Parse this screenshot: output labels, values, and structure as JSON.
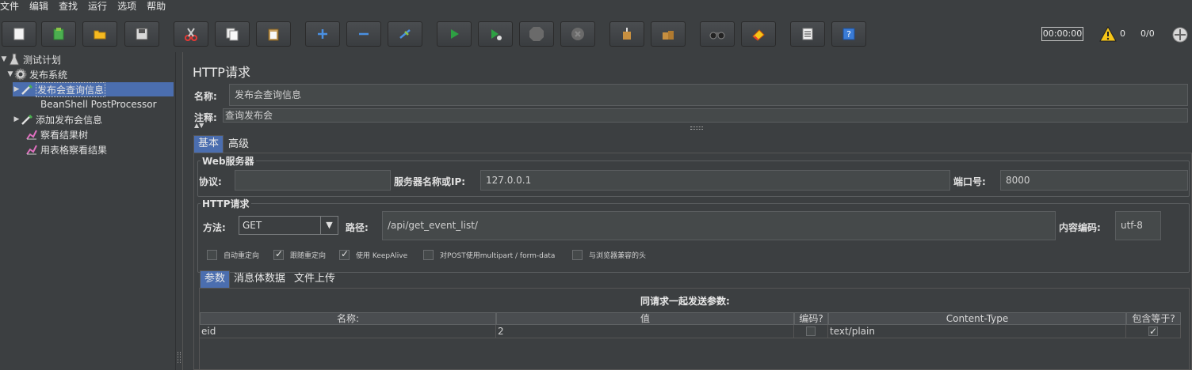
{
  "menu": [
    "文件",
    "编辑",
    "查找",
    "运行",
    "选项",
    "帮助"
  ],
  "status": {
    "timer": "00:00:00",
    "warnings": "0",
    "threads": "0/0"
  },
  "tree": {
    "nodes": [
      {
        "label": "测试计划",
        "icon": "flask-icon",
        "expanded": true
      },
      {
        "label": "发布系统",
        "icon": "gear-icon",
        "expanded": true
      },
      {
        "label": "发布会查询信息",
        "icon": "pipette-icon",
        "selected": true
      },
      {
        "label": "BeanShell PostProcessor",
        "icon": "none"
      },
      {
        "label": "添加发布会信息",
        "icon": "pipette-icon"
      },
      {
        "label": "察看结果树",
        "icon": "chart-icon"
      },
      {
        "label": "用表格察看结果",
        "icon": "chart-icon"
      }
    ]
  },
  "panel": {
    "title": "HTTP请求",
    "name_label": "名称:",
    "name_value": "发布会查询信息",
    "comment_label": "注释:",
    "comment_value": "查询发布会",
    "tabs": [
      "基本",
      "高级"
    ],
    "web_server": {
      "title": "Web服务器",
      "protocol_label": "协议:",
      "protocol_value": "",
      "server_label": "服务器名称或IP:",
      "server_value": "127.0.0.1",
      "port_label": "端口号:",
      "port_value": "8000"
    },
    "http_request": {
      "title": "HTTP请求",
      "method_label": "方法:",
      "method_value": "GET",
      "path_label": "路径:",
      "path_value": "/api/get_event_list/",
      "encoding_label": "内容编码:",
      "encoding_value": "utf-8",
      "checkboxes": [
        {
          "label": "自动重定向",
          "checked": false
        },
        {
          "label": "跟随重定向",
          "checked": true
        },
        {
          "label": "使用 KeepAlive",
          "checked": true
        },
        {
          "label": "对POST使用multipart / form-data",
          "checked": false
        },
        {
          "label": "与浏览器兼容的头",
          "checked": false
        }
      ]
    },
    "sub_tabs": [
      "参数",
      "消息体数据",
      "文件上传"
    ],
    "params": {
      "title": "同请求一起发送参数:",
      "columns": [
        "名称:",
        "值",
        "编码?",
        "Content-Type",
        "包含等于?"
      ],
      "rows": [
        {
          "name": "eid",
          "value": "2",
          "encode": false,
          "content_type": "text/plain",
          "include_equals": true
        }
      ]
    }
  }
}
